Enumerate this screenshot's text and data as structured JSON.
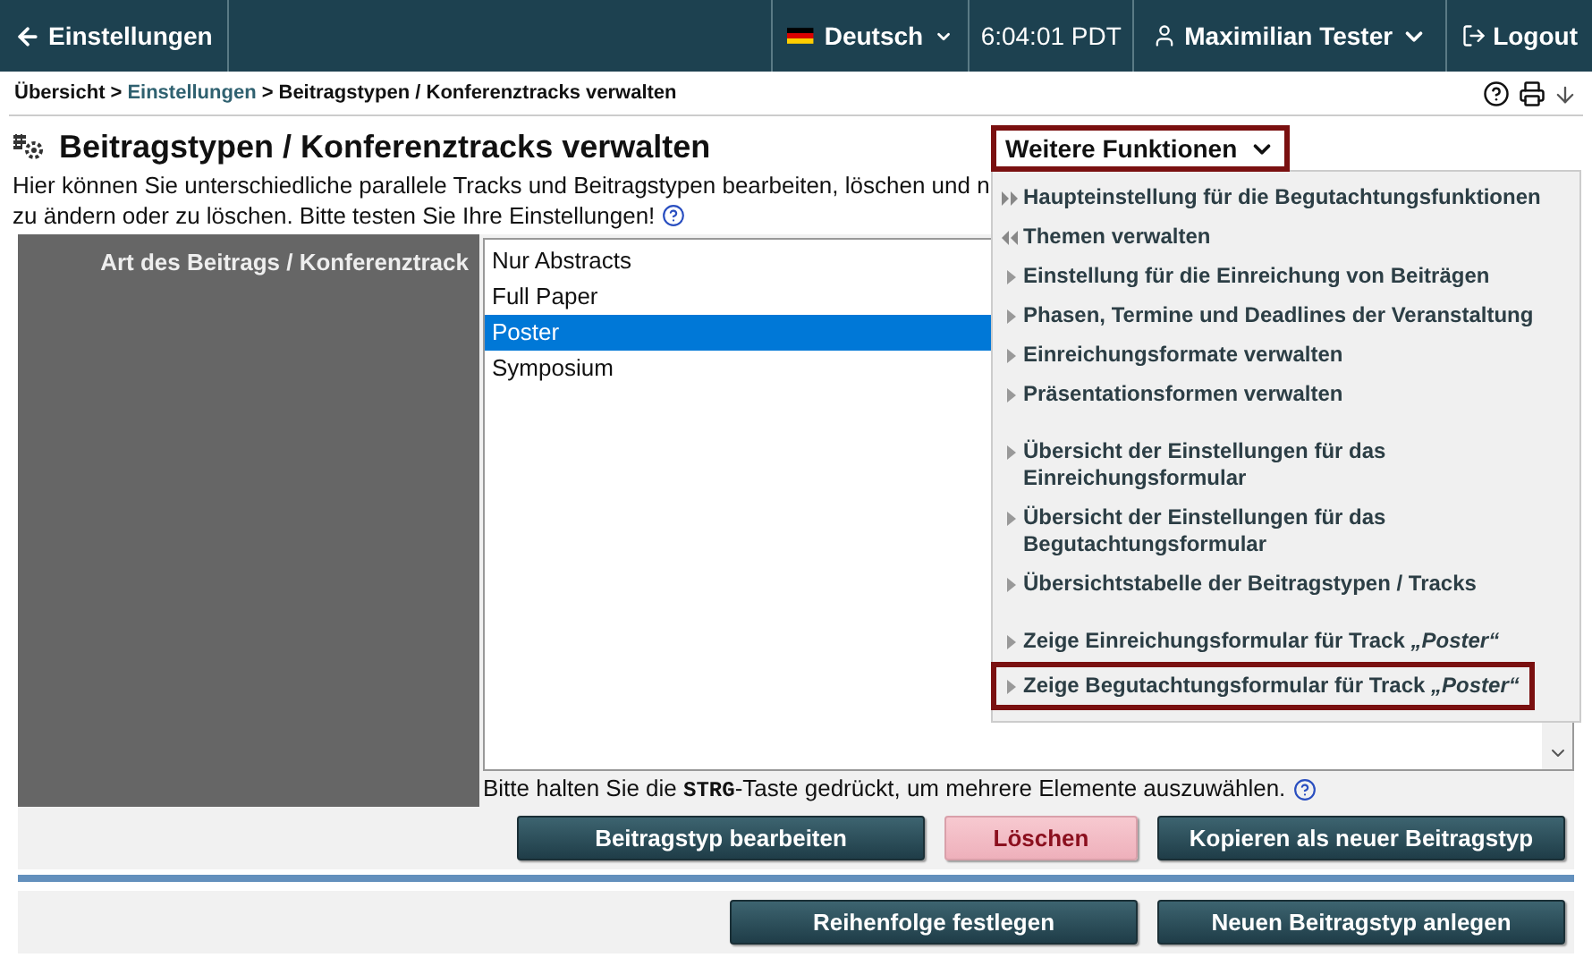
{
  "topbar": {
    "back": "Einstellungen",
    "language": "Deutsch",
    "time": "6:04:01 PDT",
    "user": "Maximilian Tester",
    "logout": "Logout"
  },
  "breadcrumb": [
    {
      "label": "Übersicht",
      "link": false
    },
    {
      "label": "Einstellungen",
      "link": true
    },
    {
      "label": "Beitragstypen / Konferenztracks verwalten",
      "link": false
    }
  ],
  "breadcrumb_separator": ">",
  "title": "Beitragstypen / Konferenztracks verwalten",
  "description_lines": [
    "Hier können Sie unterschiedliche parallele Tracks und Beitragstypen bearbeiten, löschen und n",
    "zu ändern oder zu löschen. Bitte testen Sie Ihre Einstellungen!"
  ],
  "form": {
    "label": "Art des Beitrags / Konferenztrack",
    "options": [
      {
        "label": "Nur Abstracts",
        "selected": false
      },
      {
        "label": "Full Paper",
        "selected": false
      },
      {
        "label": "Poster",
        "selected": true
      },
      {
        "label": "Symposium",
        "selected": false
      }
    ],
    "hint": {
      "before": "Bitte halten Sie die",
      "key": "STRG",
      "after": "-Taste gedrückt, um mehrere Elemente auszuwählen."
    }
  },
  "buttons": [
    {
      "label": "Beitragstyp bearbeiten",
      "kind": "primary"
    },
    {
      "label": "Löschen",
      "kind": "danger"
    },
    {
      "label": "Kopieren als neuer Beitragstyp",
      "kind": "primary"
    }
  ],
  "bottom_buttons": [
    {
      "label": "Reihenfolge festlegen",
      "kind": "primary"
    },
    {
      "label": "Neuen Beitragstyp anlegen",
      "kind": "primary"
    }
  ],
  "menu": {
    "title": "Weitere Funktionen",
    "groups": [
      {
        "items": [
          {
            "label": "Haupteinstellung für die Begutachtungsfunktionen",
            "kind": "forward",
            "highlighted": false
          },
          {
            "label": "Themen verwalten",
            "kind": "back",
            "highlighted": false
          },
          {
            "label": "Einstellung für die Einreichung von Beiträgen",
            "kind": "item",
            "highlighted": false
          },
          {
            "label": "Phasen, Termine und Deadlines der Veranstaltung",
            "kind": "item",
            "highlighted": false
          },
          {
            "label": "Einreichungsformate verwalten",
            "kind": "item",
            "highlighted": false
          },
          {
            "label": "Präsentationsformen verwalten",
            "kind": "item",
            "highlighted": false
          }
        ]
      },
      {
        "items": [
          {
            "label": "Übersicht der Einstellungen für das Einreichungsformular",
            "kind": "item",
            "highlighted": false
          },
          {
            "label": "Übersicht der Einstellungen für das Begutachtungsformular",
            "kind": "item",
            "highlighted": false
          },
          {
            "label": "Übersichtstabelle der Beitragstypen / Tracks",
            "kind": "item",
            "highlighted": false
          }
        ]
      },
      {
        "items": [
          {
            "label": "Zeige Einreichungsformular für Track *„Poster“*",
            "kind": "item",
            "highlighted": false
          },
          {
            "label": "Zeige Begutachtungsformular für Track *„Poster“*",
            "kind": "item",
            "highlighted": true
          }
        ]
      }
    ]
  }
}
